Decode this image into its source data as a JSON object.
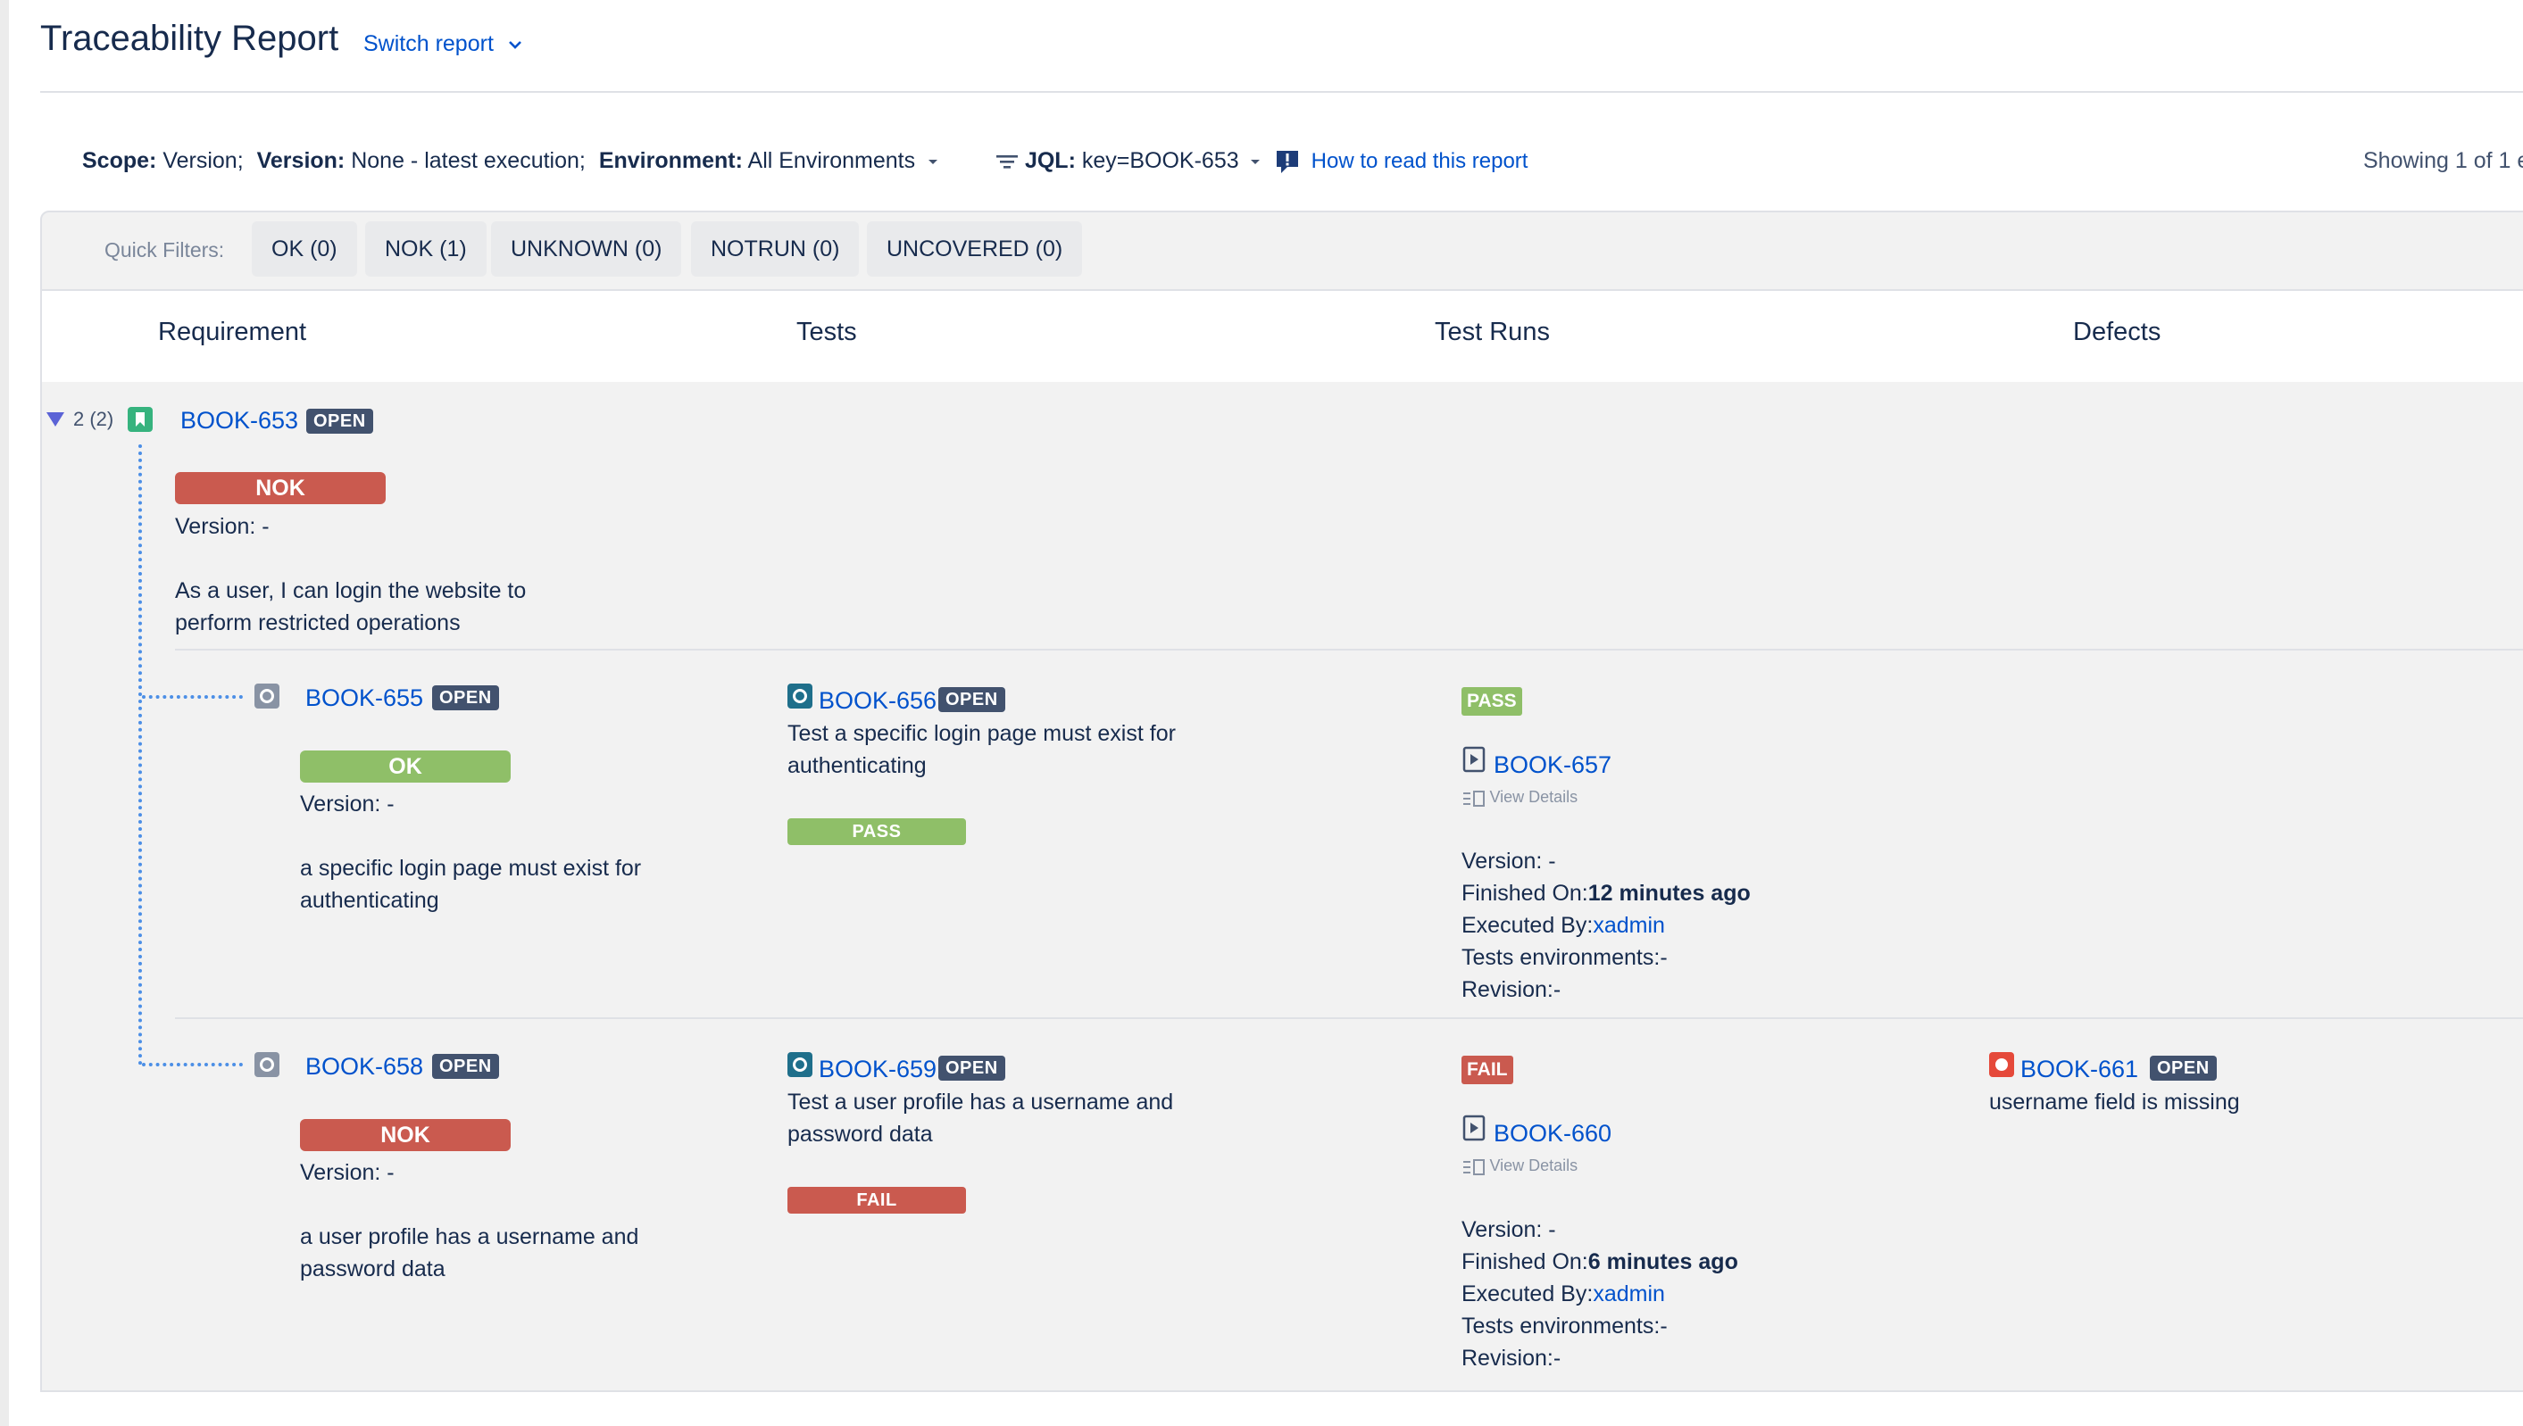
{
  "header": {
    "title": "Traceability Report",
    "switch_report": "Switch report"
  },
  "scope_bar": {
    "scope_label": "Scope:",
    "scope_value": "Version;",
    "version_label": "Version:",
    "version_value": "None - latest execution;",
    "environment_label": "Environment:",
    "environment_value": "All Environments",
    "jql_label": "JQL:",
    "jql_value": "key=BOOK-653",
    "how_to_read": "How to read this report",
    "showing": "Showing 1 of 1 e"
  },
  "quick_filters": {
    "label": "Quick Filters:",
    "buttons": [
      "OK (0)",
      "NOK (1)",
      "UNKNOWN (0)",
      "NOTRUN (0)",
      "UNCOVERED (0)"
    ]
  },
  "columns": [
    "Requirement",
    "Tests",
    "Test Runs",
    "Defects"
  ],
  "requirement": {
    "count": "2 (2)",
    "key": "BOOK-653",
    "status": "OPEN",
    "coverage": "NOK",
    "version": "Version: -",
    "summary_line1": "As a user, I can login the website to",
    "summary_line2": "perform restricted operations"
  },
  "rows": [
    {
      "req_key": "BOOK-655",
      "req_status": "OPEN",
      "coverage": "OK",
      "version": "Version: -",
      "summary_line1": "a specific login page must exist for",
      "summary_line2": "authenticating",
      "test_key": "BOOK-656",
      "test_status": "OPEN",
      "test_summary_line1": "Test a specific login page must exist for",
      "test_summary_line2": "authenticating",
      "test_result": "PASS",
      "run_result": "PASS",
      "run_key": "BOOK-657",
      "view_details": "View Details",
      "run_version": "Version: -",
      "finished_label": "Finished On:",
      "finished_value": "12 minutes ago",
      "executed_label": "Executed By:",
      "executed_value": "xadmin",
      "environments": "Tests environments:-",
      "revision": "Revision:-"
    },
    {
      "req_key": "BOOK-658",
      "req_status": "OPEN",
      "coverage": "NOK",
      "version": "Version: -",
      "summary_line1": "a user profile has a username and",
      "summary_line2": "password data",
      "test_key": "BOOK-659",
      "test_status": "OPEN",
      "test_summary_line1": "Test a user profile has a username and",
      "test_summary_line2": "password data",
      "test_result": "FAIL",
      "run_result": "FAIL",
      "run_key": "BOOK-660",
      "view_details": "View Details",
      "run_version": "Version: -",
      "finished_label": "Finished On:",
      "finished_value": "6 minutes ago",
      "executed_label": "Executed By:",
      "executed_value": "xadmin",
      "environments": "Tests environments:-",
      "revision": "Revision:-",
      "defect_key": "BOOK-661",
      "defect_status": "OPEN",
      "defect_summary": "username field is missing"
    }
  ],
  "colors": {
    "nok": "#ca5a4f",
    "ok": "#8fbf68",
    "link": "#0052cc",
    "lozenge": "#42526e"
  }
}
